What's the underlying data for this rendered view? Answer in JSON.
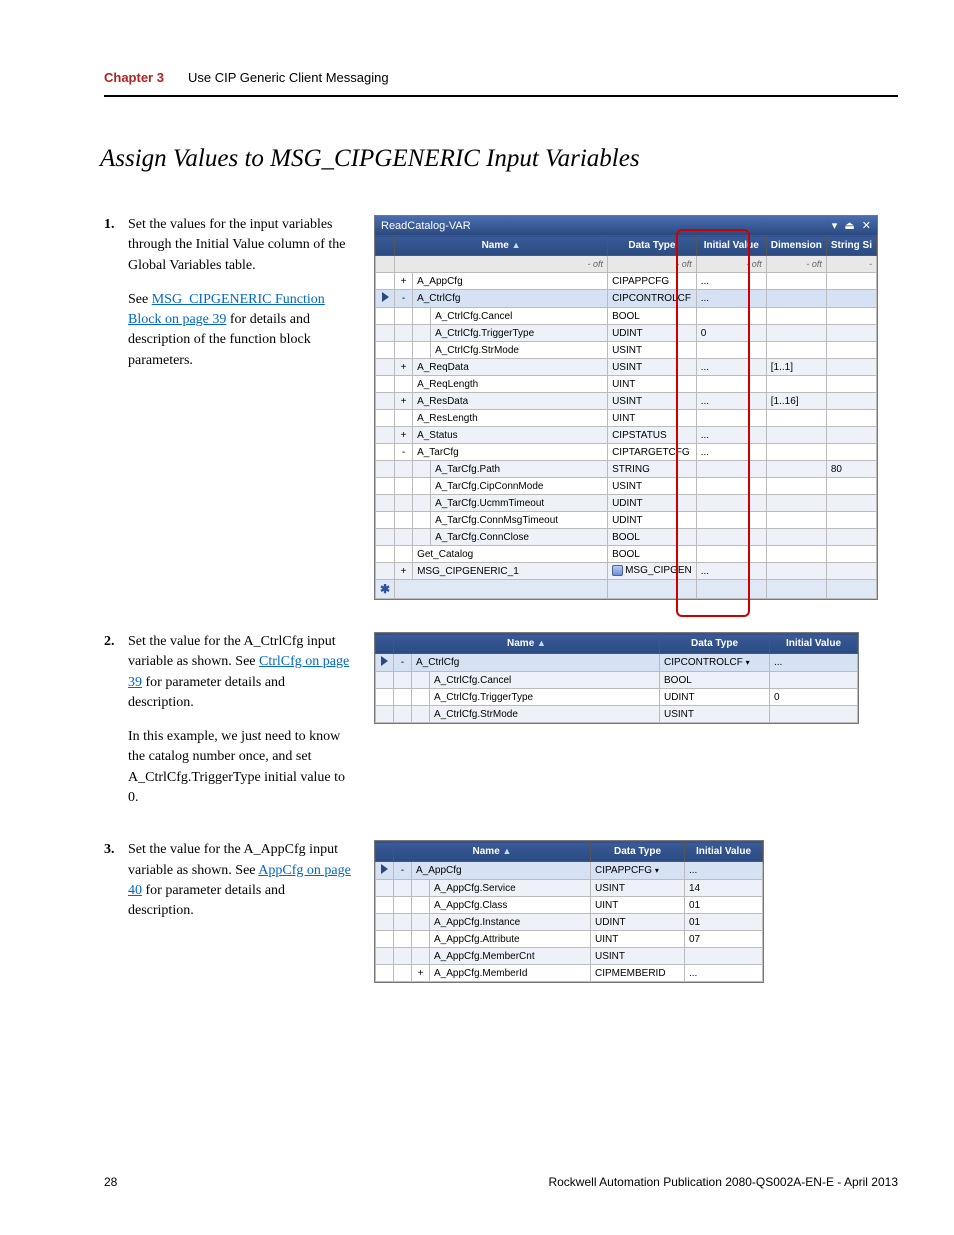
{
  "header": {
    "chapter": "Chapter 3",
    "title": "Use CIP Generic Client Messaging"
  },
  "heading": "Assign Values to MSG_CIPGENERIC Input Variables",
  "steps": {
    "s1": {
      "num": "1.",
      "text": "Set the values for the input variables through the Initial Value column of the Global Variables table.",
      "extra_pre": "See ",
      "link": "MSG_CIPGENERIC Function Block on page 39",
      "extra_post": " for details and description of the function block parameters."
    },
    "s2": {
      "num": "2.",
      "pre": "Set the value for the A_CtrlCfg input variable as shown. See ",
      "link": "CtrlCfg on page 39",
      "post": "  for parameter details and description.",
      "note": "In this example, we just need to know the catalog number once, and set A_CtrlCfg.TriggerType initial value to 0."
    },
    "s3": {
      "num": "3.",
      "pre": "Set the value for the A_AppCfg input variable as shown. See ",
      "link": "AppCfg on page 40",
      "post": " for parameter details and description."
    }
  },
  "grid1": {
    "panel_title": "ReadCatalog-VAR",
    "cols": {
      "c1": "Name",
      "c2": "Data Type",
      "c3": "Initial Value",
      "c4": "Dimension",
      "c5": "String Si"
    },
    "filter_placeholder": "- oft",
    "rows": [
      {
        "exp": "+",
        "name": "A_AppCfg",
        "dt": "CIPAPPCFG",
        "iv": "...",
        "dim": "",
        "ss": "",
        "top": true
      },
      {
        "exp": "-",
        "name": "A_CtrlCfg",
        "dt": "CIPCONTROLCF",
        "iv": "...",
        "dim": "",
        "ss": "",
        "top": true,
        "current": true
      },
      {
        "child": true,
        "name": "A_CtrlCfg.Cancel",
        "dt": "BOOL",
        "iv": "",
        "dim": "",
        "ss": ""
      },
      {
        "child": true,
        "name": "A_CtrlCfg.TriggerType",
        "dt": "UDINT",
        "iv": "0",
        "dim": "",
        "ss": ""
      },
      {
        "child": true,
        "name": "A_CtrlCfg.StrMode",
        "dt": "USINT",
        "iv": "",
        "dim": "",
        "ss": ""
      },
      {
        "exp": "+",
        "name": "A_ReqData",
        "dt": "USINT",
        "iv": "...",
        "dim": "[1..1]",
        "ss": "",
        "top": true
      },
      {
        "exp": "",
        "name": "A_ReqLength",
        "dt": "UINT",
        "iv": "",
        "dim": "",
        "ss": "",
        "top": true
      },
      {
        "exp": "+",
        "name": "A_ResData",
        "dt": "USINT",
        "iv": "...",
        "dim": "[1..16]",
        "ss": "",
        "top": true
      },
      {
        "exp": "",
        "name": "A_ResLength",
        "dt": "UINT",
        "iv": "",
        "dim": "",
        "ss": "",
        "top": true
      },
      {
        "exp": "+",
        "name": "A_Status",
        "dt": "CIPSTATUS",
        "iv": "...",
        "dim": "",
        "ss": "",
        "top": true
      },
      {
        "exp": "-",
        "name": "A_TarCfg",
        "dt": "CIPTARGETCFG",
        "iv": "...",
        "dim": "",
        "ss": "",
        "top": true
      },
      {
        "child": true,
        "name": "A_TarCfg.Path",
        "dt": "STRING",
        "iv": "",
        "dim": "",
        "ss": "80"
      },
      {
        "child": true,
        "name": "A_TarCfg.CipConnMode",
        "dt": "USINT",
        "iv": "",
        "dim": "",
        "ss": ""
      },
      {
        "child": true,
        "name": "A_TarCfg.UcmmTimeout",
        "dt": "UDINT",
        "iv": "",
        "dim": "",
        "ss": ""
      },
      {
        "child": true,
        "name": "A_TarCfg.ConnMsgTimeout",
        "dt": "UDINT",
        "iv": "",
        "dim": "",
        "ss": ""
      },
      {
        "child": true,
        "name": "A_TarCfg.ConnClose",
        "dt": "BOOL",
        "iv": "",
        "dim": "",
        "ss": ""
      },
      {
        "exp": "",
        "name": "Get_Catalog",
        "dt": "BOOL",
        "iv": "",
        "dim": "",
        "ss": "",
        "top": true
      },
      {
        "exp": "+",
        "name": "MSG_CIPGENERIC_1",
        "dt": "MSG_CIPGEN",
        "iv": "...",
        "dim": "",
        "ss": "",
        "top": true,
        "fb": true
      }
    ]
  },
  "grid2": {
    "cols": {
      "c1": "Name",
      "c2": "Data Type",
      "c3": "Initial Value"
    },
    "rows": [
      {
        "exp": "-",
        "name": "A_CtrlCfg",
        "dt": "CIPCONTROLCF",
        "dtTrailing": "▾",
        "iv": "...",
        "top": true,
        "current": true
      },
      {
        "child": true,
        "name": "A_CtrlCfg.Cancel",
        "dt": "BOOL",
        "iv": ""
      },
      {
        "child": true,
        "name": "A_CtrlCfg.TriggerType",
        "dt": "UDINT",
        "iv": "0"
      },
      {
        "child": true,
        "name": "A_CtrlCfg.StrMode",
        "dt": "USINT",
        "iv": ""
      }
    ]
  },
  "grid3": {
    "cols": {
      "c1": "Name",
      "c2": "Data Type",
      "c3": "Initial Value"
    },
    "rows": [
      {
        "exp": "-",
        "name": "A_AppCfg",
        "dt": "CIPAPPCFG",
        "dtTrailing": "▾",
        "iv": "...",
        "top": true,
        "current": true
      },
      {
        "child": true,
        "name": "A_AppCfg.Service",
        "dt": "USINT",
        "iv": "14"
      },
      {
        "child": true,
        "name": "A_AppCfg.Class",
        "dt": "UINT",
        "iv": "01"
      },
      {
        "child": true,
        "name": "A_AppCfg.Instance",
        "dt": "UDINT",
        "iv": "01"
      },
      {
        "child": true,
        "name": "A_AppCfg.Attribute",
        "dt": "UINT",
        "iv": "07"
      },
      {
        "child": true,
        "name": "A_AppCfg.MemberCnt",
        "dt": "USINT",
        "iv": ""
      },
      {
        "child": true,
        "exp": "+",
        "name": "A_AppCfg.MemberId",
        "dt": "CIPMEMBERID",
        "iv": "..."
      }
    ]
  },
  "footer": {
    "page": "28",
    "pub": "Rockwell Automation Publication 2080-QS002A-EN-E - April 2013"
  }
}
